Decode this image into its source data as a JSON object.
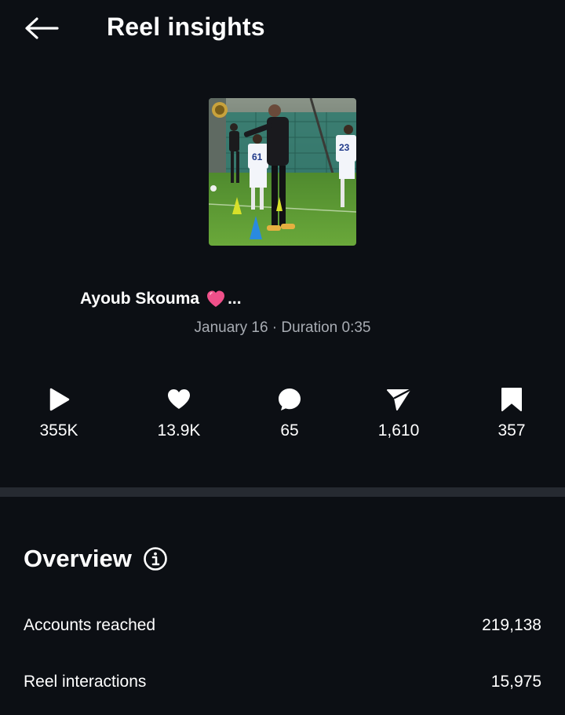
{
  "header": {
    "title": "Reel insights",
    "back_icon": "arrow-left-icon"
  },
  "reel": {
    "thumbnail_description_icon": "video-thumbnail",
    "author": "Ayoub Skouma",
    "author_suffix": "...",
    "author_emoji_icon": "pink-heart-icon",
    "meta": "January 16 · Duration 0:35"
  },
  "metrics": [
    {
      "icon": "play-icon",
      "value": "355K"
    },
    {
      "icon": "heart-icon",
      "value": "13.9K"
    },
    {
      "icon": "comment-icon",
      "value": "65"
    },
    {
      "icon": "share-icon",
      "value": "1,610"
    },
    {
      "icon": "bookmark-icon",
      "value": "357"
    }
  ],
  "overview": {
    "title": "Overview",
    "info_icon": "info-icon",
    "rows": [
      {
        "label": "Accounts reached",
        "value": "219,138"
      },
      {
        "label": "Reel interactions",
        "value": "15,975"
      }
    ]
  },
  "colors": {
    "background": "#0c0f14",
    "divider": "#262a31",
    "secondary_text": "#a8acb3",
    "emoji_heart": "#f0508a"
  }
}
